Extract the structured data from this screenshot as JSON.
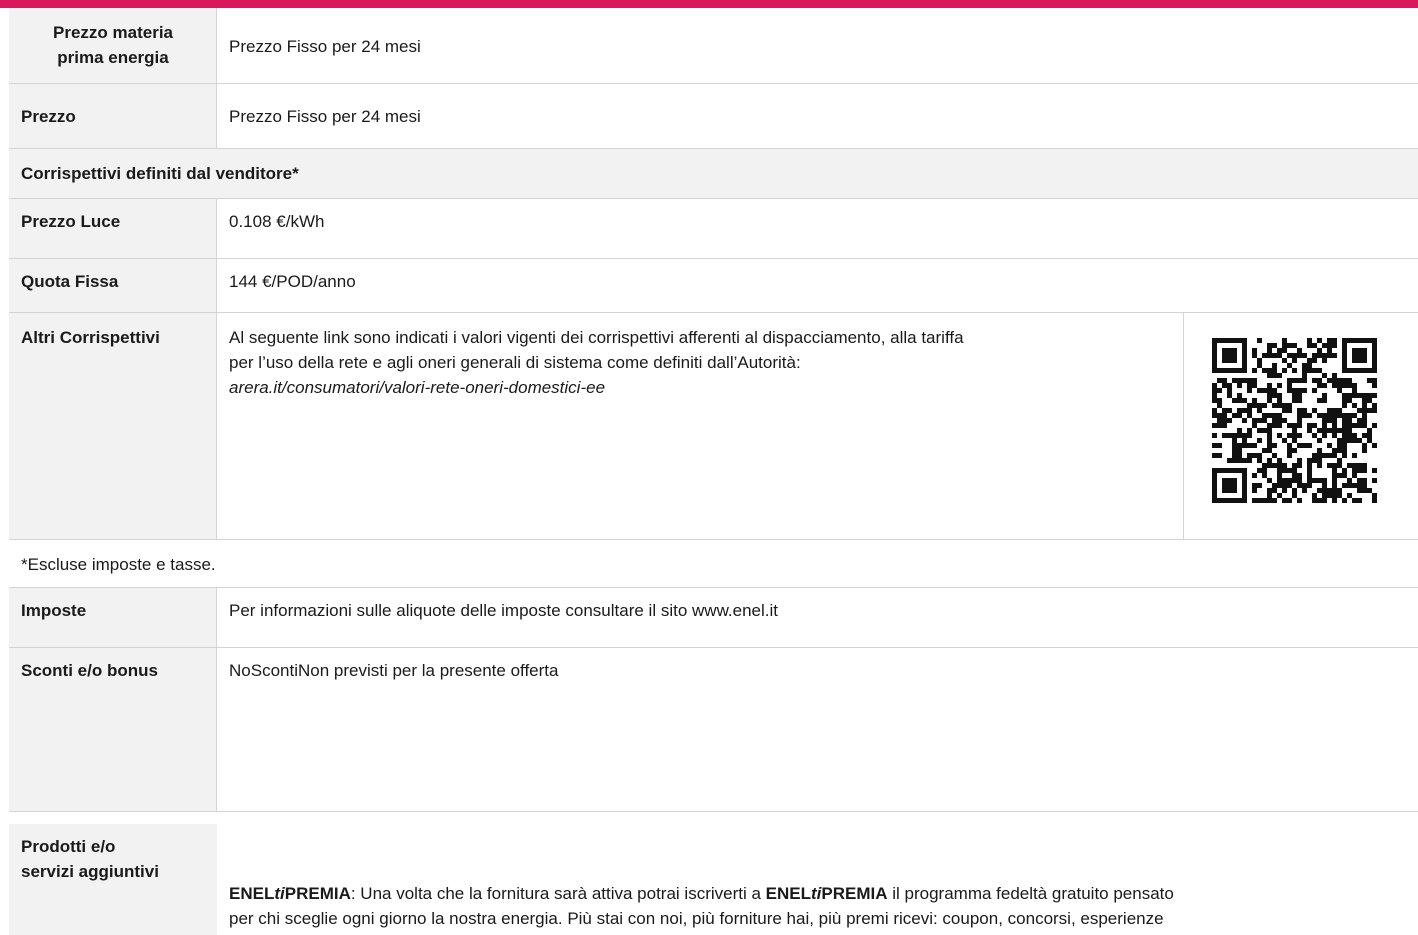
{
  "brand": {
    "accent": "#d8175c",
    "label_bg": "#f2f2f2",
    "border": "#d4d4d4"
  },
  "rows": {
    "materia_prima": {
      "label": "Prezzo materia prima energia",
      "label_l1": "Prezzo materia",
      "label_l2": "prima energia",
      "value": "Prezzo Fisso per 24 mesi"
    },
    "prezzo": {
      "label": "Prezzo",
      "value": "Prezzo Fisso per 24 mesi"
    },
    "section_title": "Corrispettivi definiti dal venditore*",
    "prezzo_luce": {
      "label": "Prezzo Luce",
      "value": "0.108 €/kWh"
    },
    "quota_fissa": {
      "label": "Quota Fissa",
      "value": "144 €/POD/anno"
    },
    "altri": {
      "label": "Altri Corrispettivi",
      "line1": "Al seguente link sono indicati i valori vigenti dei corrispettivi afferenti al dispacciamento, alla tariffa",
      "line2": "per l’uso della rete e agli oneri generali di sistema come definiti dall’Autorità:",
      "link": "arera.it/consumatori/valori-rete-oneri-domestici-ee",
      "qr_icon": "qr-code-icon"
    },
    "note": "*Escluse imposte e tasse.",
    "imposte": {
      "label": "Imposte",
      "value": "Per informazioni sulle aliquote delle imposte consultare il sito www.enel.it"
    },
    "sconti": {
      "label": "Sconti e/o bonus",
      "value": "NoScontiNon previsti per la presente offerta"
    },
    "prodotti": {
      "label": "Prodotti e/o servizi aggiuntivi",
      "label_l1": "Prodotti e/o",
      "label_l2": "servizi aggiuntivi",
      "brand_a": "ENEL",
      "brand_b": "ti",
      "brand_c": "PREMIA",
      "text1": ": Una volta che la fornitura sarà attiva potrai iscriverti a ",
      "text2": " il programma fedeltà gratuito pensato",
      "text3": "per chi sceglie ogni giorno la nostra energia. Più stai con noi, più forniture hai, più premi ricevi: coupon, concorsi, esperienze"
    }
  }
}
